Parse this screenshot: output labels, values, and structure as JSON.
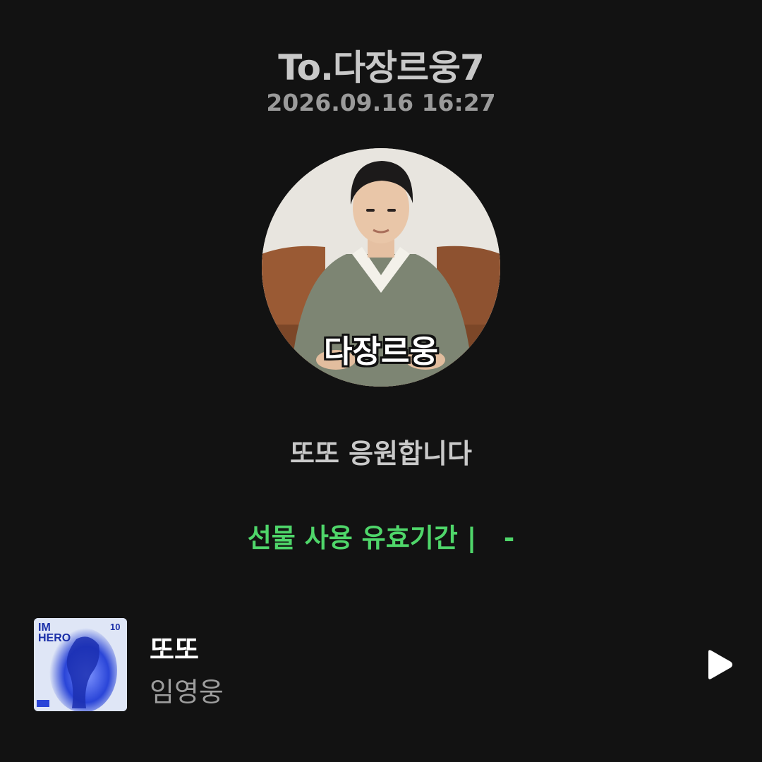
{
  "header": {
    "recipient": "To.다장르웅7",
    "datetime": "2026.09.16 16:27"
  },
  "avatar": {
    "caption": "다장르웅"
  },
  "message": "또또 응원합니다",
  "validity": {
    "text": "선물 사용 유효기간 |   -"
  },
  "track": {
    "title": "또또",
    "artist": "임영웅",
    "album_art_text": "IM HERO"
  },
  "colors": {
    "background": "#121212",
    "accent_green": "#4fd66a",
    "album_blue": "#2a45d8"
  },
  "icons": {
    "play": "play-icon"
  }
}
